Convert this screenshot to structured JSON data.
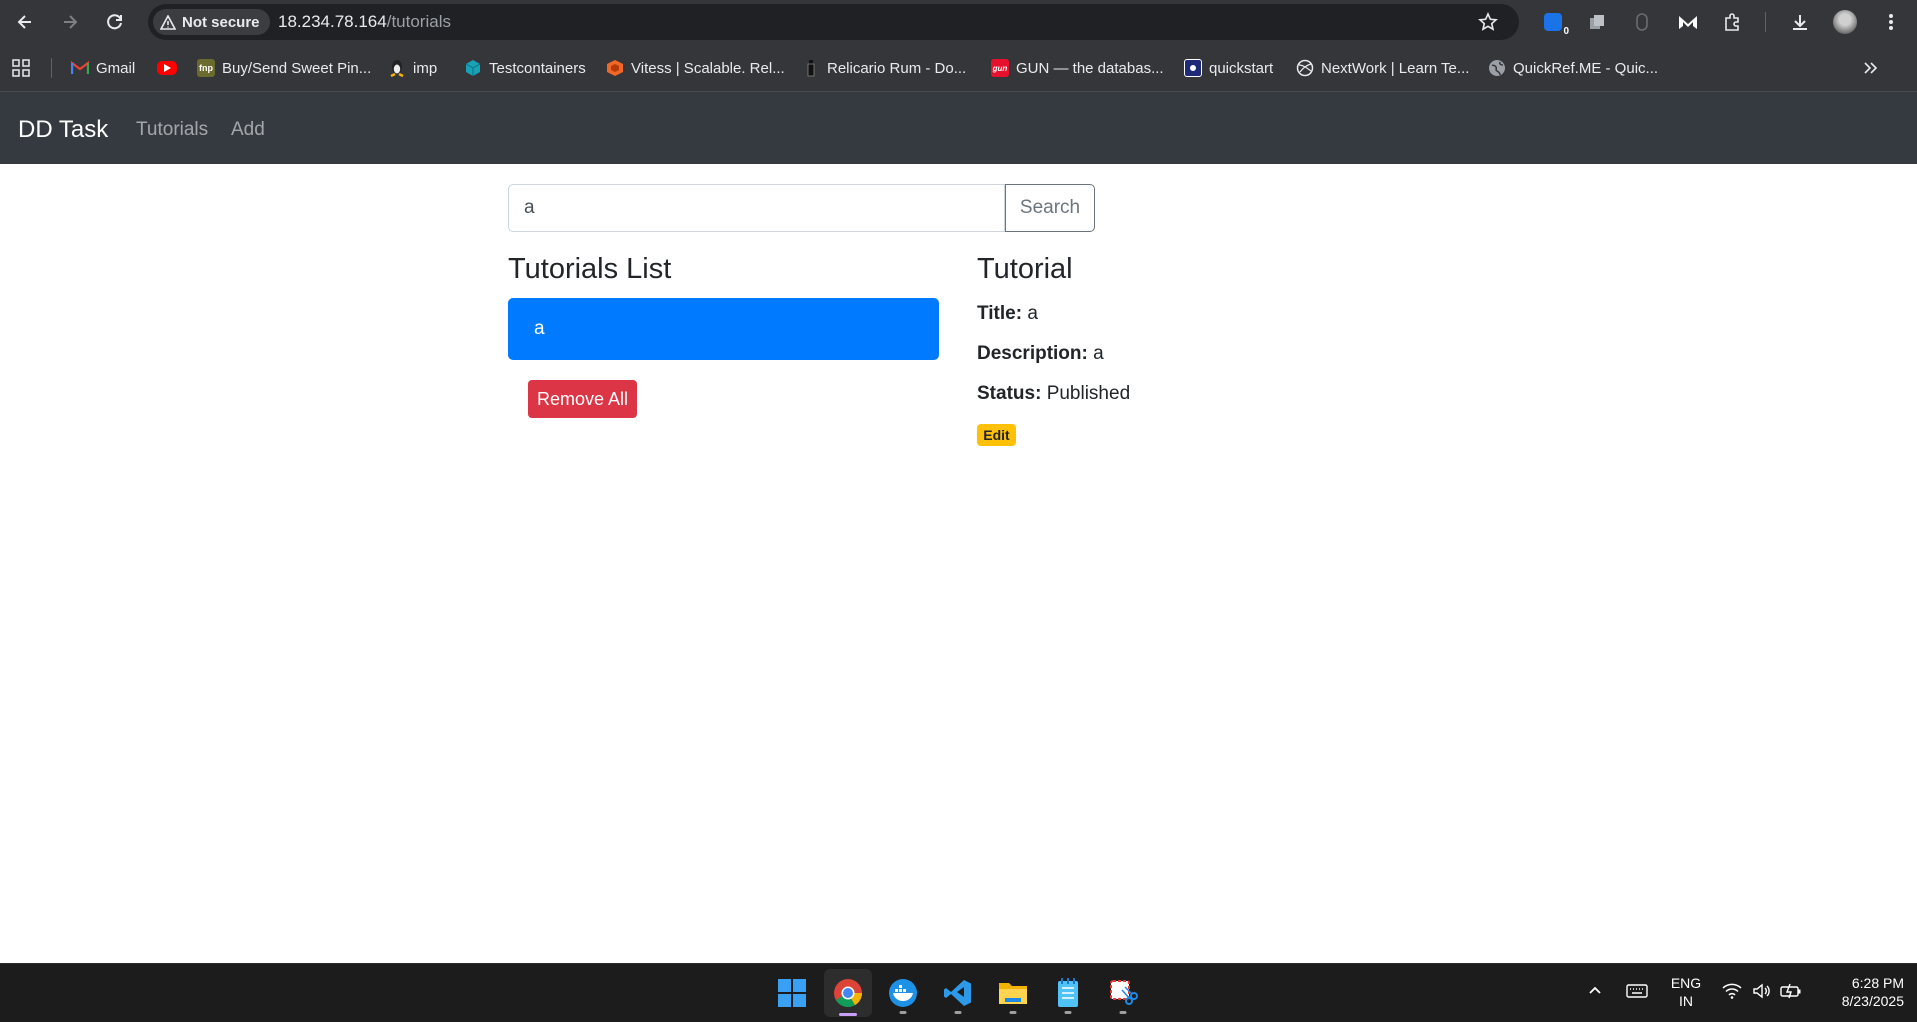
{
  "browser": {
    "security_label": "Not secure",
    "url_host": "18.234.78.164",
    "url_path": "/tutorials",
    "extension_badge": "0"
  },
  "bookmarks": [
    {
      "label": "Gmail",
      "icon": "gmail-icon"
    },
    {
      "label": "",
      "icon": "youtube-icon"
    },
    {
      "label": "Buy/Send Sweet Pin...",
      "icon": "fnp-icon"
    },
    {
      "label": "imp",
      "icon": "linux-penguin-icon"
    },
    {
      "label": "Testcontainers",
      "icon": "testcontainers-icon"
    },
    {
      "label": "Vitess | Scalable. Rel...",
      "icon": "vitess-icon"
    },
    {
      "label": "Relicario Rum - Do...",
      "icon": "relicario-icon"
    },
    {
      "label": "GUN — the databas...",
      "icon": "gun-icon"
    },
    {
      "label": "quickstart",
      "icon": "quickstart-icon"
    },
    {
      "label": "NextWork | Learn Te...",
      "icon": "nextwork-icon"
    },
    {
      "label": "QuickRef.ME - Quic...",
      "icon": "globe-icon"
    }
  ],
  "app": {
    "brand": "DD Task",
    "nav": [
      "Tutorials",
      "Add"
    ]
  },
  "search": {
    "value": "a",
    "button_label": "Search"
  },
  "list": {
    "heading": "Tutorials List",
    "items": [
      "a"
    ],
    "remove_all_label": "Remove All"
  },
  "detail": {
    "heading": "Tutorial",
    "title_label": "Title:",
    "title_value": "a",
    "description_label": "Description:",
    "description_value": "a",
    "status_label": "Status:",
    "status_value": "Published",
    "edit_label": "Edit"
  },
  "colors": {
    "navbar": "#343a40",
    "primary": "#007bff",
    "danger": "#dc3545",
    "warning": "#ffc107"
  },
  "taskbar": {
    "apps": [
      "windows-start-icon",
      "chrome-icon",
      "docker-icon",
      "vscode-icon",
      "file-explorer-icon",
      "notepad-icon",
      "snipping-tool-icon"
    ],
    "language_line1": "ENG",
    "language_line2": "IN",
    "time": "6:28 PM",
    "date": "8/23/2025"
  }
}
